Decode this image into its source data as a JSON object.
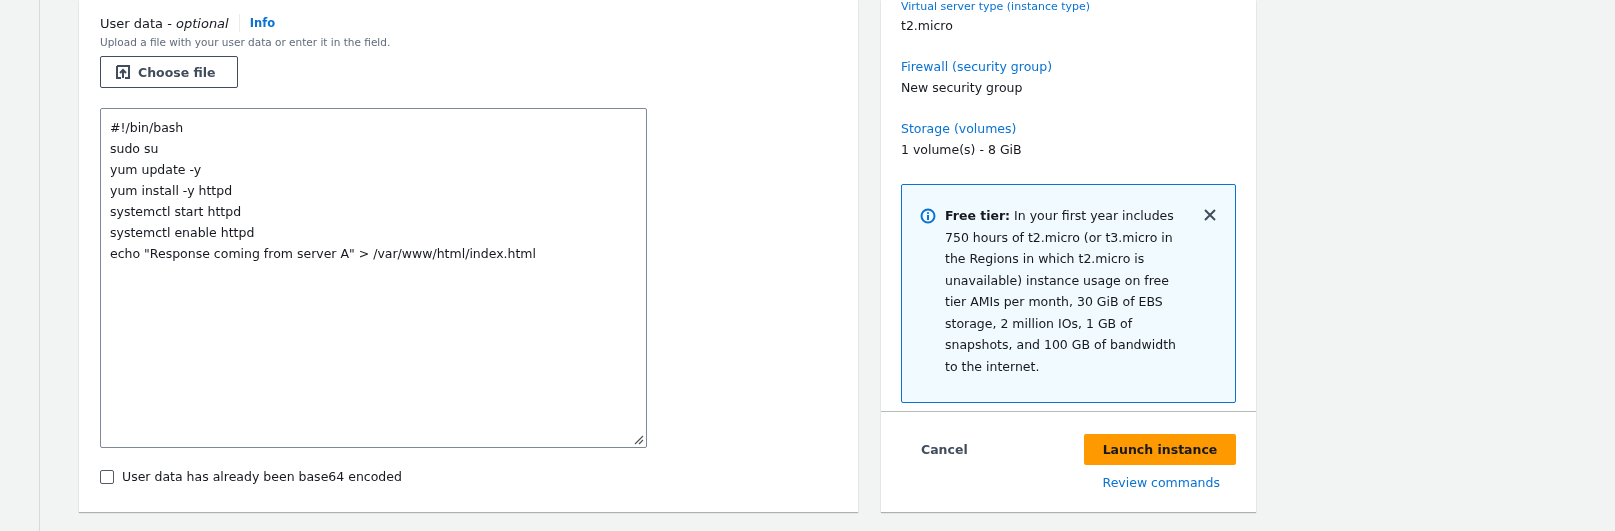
{
  "user_data": {
    "label": "User data - *optional*",
    "info": "Info",
    "description": "Upload a file with your user data or enter it in the field.",
    "choose_file": "Choose file",
    "lines": [
      "#!/bin/bash",
      "sudo su",
      "yum update -y",
      "yum install -y httpd",
      "systemctl start httpd",
      "systemctl enable httpd",
      "echo \"Response coming from server A\" > /var/www/html/index.html"
    ],
    "base64": {
      "label": "User data has already been base64 encoded",
      "checked": false
    }
  },
  "summary": {
    "items": [
      {
        "label": "Virtual server type (instance type)",
        "value": "t2.micro"
      },
      {
        "label": "Firewall (security group)",
        "value": "New security group"
      },
      {
        "label": "Storage (volumes)",
        "value": "1 volume(s) - 8 GiB"
      }
    ],
    "free_tier": "**Free tier:** In your first year includes 750 hours of t2.micro (or t3.micro in the Regions in which t2.micro is unavailable) instance usage on free tier AMIs per month, 30 GiB of EBS storage, 2 million IOs, 1 GB of snapshots, and 100 GB of bandwidth to the internet.",
    "cancel": "Cancel",
    "launch": "Launch instance",
    "review": "Review commands"
  }
}
